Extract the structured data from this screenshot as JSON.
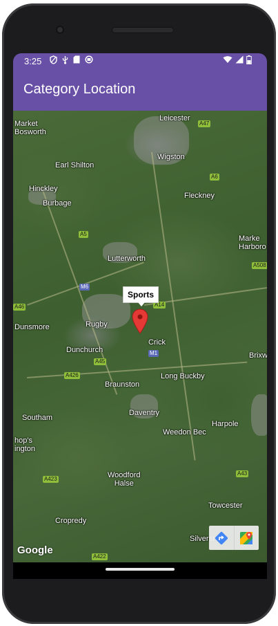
{
  "status_bar": {
    "time": "3:25",
    "left_icons": [
      "shield-icon",
      "usb-icon",
      "sd-card-icon",
      "sync-icon"
    ],
    "right_icons": [
      "wifi-icon",
      "signal-icon",
      "battery-icon"
    ]
  },
  "app_bar": {
    "title": "Category Location",
    "color": "#6950a7"
  },
  "map": {
    "places": {
      "leicester": "Leicester",
      "market_bosworth": "Market\nBosworth",
      "earl_shilton": "Earl Shilton",
      "wigston": "Wigston",
      "hinckley": "Hinckley",
      "burbage": "Burbage",
      "fleckney": "Fleckney",
      "market_harborough": "Marke\nHarboro",
      "lutterworth": "Lutterworth",
      "rugby": "Rugby",
      "dunsmore": "Dunsmore",
      "crick": "Crick",
      "dunchurch": "Dunchurch",
      "brixworth": "Brixw",
      "braunston": "Braunston",
      "long_buckby": "Long Buckby",
      "southam": "Southam",
      "daventry": "Daventry",
      "harpole": "Harpole",
      "weedon_bec": "Weedon Bec",
      "bishops_itchington": "hop's\nington",
      "woodford_halse": "Woodford\nHalse",
      "towcester": "Towcester",
      "cropredy": "Cropredy",
      "silverstone": "Silverst"
    },
    "roads": {
      "a47": "A47",
      "a6": "A6",
      "a5": "A5",
      "m6": "M6",
      "a46": "A46",
      "a14": "A14",
      "m1": "M1",
      "a45": "A45",
      "a426": "A426",
      "a508": "A508",
      "a43": "A43",
      "a423": "A423",
      "a422": "A422"
    },
    "marker": {
      "title": "Sports",
      "color": "#e53935"
    },
    "attribution": "Google"
  },
  "map_toolbar": {
    "directions_icon": "directions-icon",
    "open_maps_icon": "google-maps-icon"
  }
}
